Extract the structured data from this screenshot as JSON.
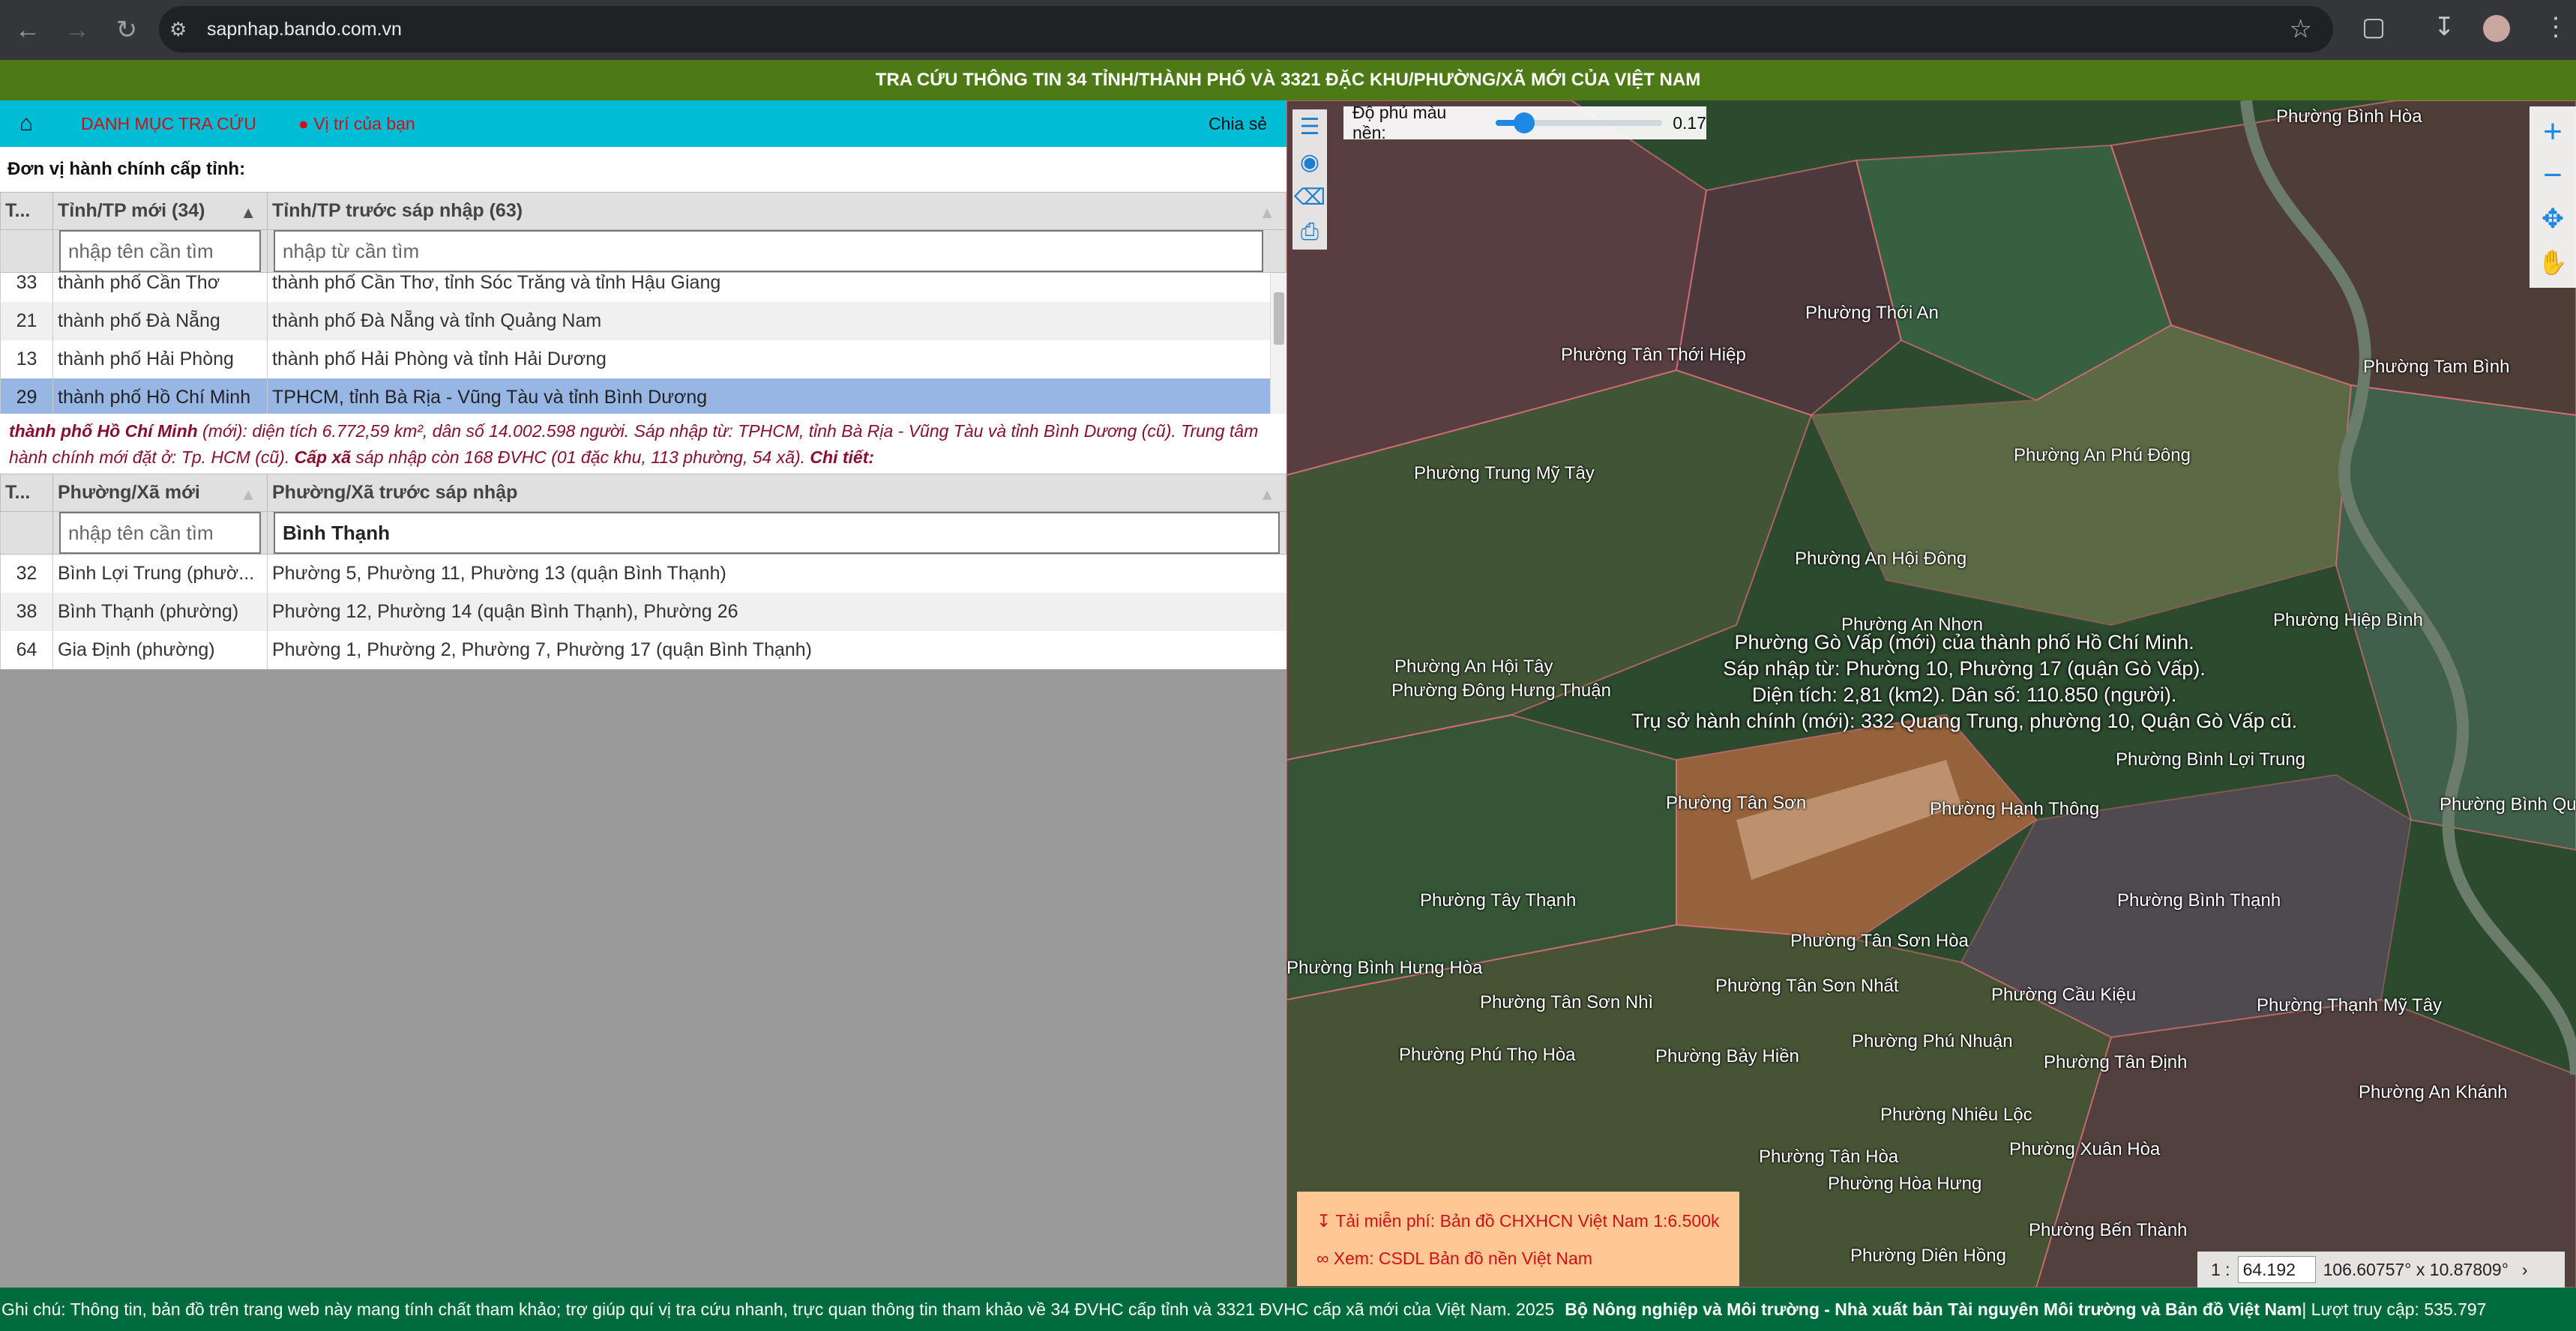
{
  "browser": {
    "url": "sapnhap.bando.com.vn"
  },
  "banner": {
    "title": "TRA CỨU THÔNG TIN 34 TỈNH/THÀNH PHỐ VÀ 3321 ĐẶC KHU/PHƯỜNG/XÃ MỚI CỦA VIỆT NAM"
  },
  "menu": {
    "catalog": "DANH MỤC TRA CỨU",
    "location": "Vị trí của bạn",
    "share": "Chia sẻ"
  },
  "province_section": {
    "label": "Đơn vị hành chính cấp tỉnh:"
  },
  "province_table": {
    "headers": [
      "T...",
      "Tỉnh/TP mới (34)",
      "Tỉnh/TP trước sáp nhập (63)"
    ],
    "filter_new_placeholder": "nhập tên cần tìm",
    "filter_old_placeholder": "nhập từ cần tìm",
    "rows": [
      {
        "no": "33",
        "new": "thành phố Cần Thơ",
        "old": "thành phố Cần Thơ, tỉnh Sóc Trăng và tỉnh Hậu Giang"
      },
      {
        "no": "21",
        "new": "thành phố Đà Nẵng",
        "old": "thành phố Đà Nẵng và tỉnh Quảng Nam"
      },
      {
        "no": "13",
        "new": "thành phố Hải Phòng",
        "old": "thành phố Hải Phòng và tỉnh Hải Dương"
      },
      {
        "no": "29",
        "new": "thành phố Hồ Chí Minh",
        "old": "TPHCM, tỉnh Bà Rịa - Vũng Tàu và tỉnh Bình Dương"
      }
    ]
  },
  "info": {
    "name": "thành phố Hồ Chí Minh",
    "line1": " (mới): diện tích 6.772,59 km², dân số 14.002.598 người. Sáp nhập từ: TPHCM, tỉnh Bà Rịa - Vũng Tàu và tỉnh Bình Dương (cũ). Trung tâm hành chính mới đặt ở: Tp. HCM (cũ). ",
    "cap_xa": "Cấp xã",
    "line2": " sáp nhập còn 168 ĐVHC (01 đặc khu, 113 phường, 54 xã). ",
    "detail": "Chi tiết:"
  },
  "ward_table": {
    "headers": [
      "T...",
      "Phường/Xã mới",
      "Phường/Xã trước sáp nhập"
    ],
    "filter_new_placeholder": "nhập tên cần tìm",
    "filter_old_value": "Bình Thạnh",
    "rows": [
      {
        "no": "32",
        "new": "Bình Lợi Trung (phườ...",
        "old": "Phường 5, Phường 11, Phường 13 (quận Bình Thạnh)"
      },
      {
        "no": "38",
        "new": "Bình Thạnh (phường)",
        "old": "Phường 12, Phường 14 (quận Bình Thạnh), Phường 26"
      },
      {
        "no": "64",
        "new": "Gia Định (phường)",
        "old": "Phường 1, Phường 2, Phường 7, Phường 17 (quận Bình Thạnh)"
      }
    ]
  },
  "map": {
    "opacity_label": "Độ phủ màu nền:",
    "opacity_value": "0.17",
    "opacity_level": 0.17,
    "labels": [
      "Phường Bình Hòa",
      "Phường Thới An",
      "Phường Tân Thới Hiệp",
      "Phường Tam Bình",
      "Phường An Phú Đông",
      "Phường Trung Mỹ Tây",
      "Phường An Hội Đông",
      "Phường Hiệp Bình",
      "Phường An Nhơn",
      "Phường An Hội Tây",
      "Phường Đông Hưng Thuận",
      "Phường Bình Lợi Trung",
      "Phường Tân Sơn",
      "Phường Hạnh Thông",
      "Phường Bình Quới",
      "Phường Tây Thạnh",
      "Phường Bình Thạnh",
      "Phường Tân Sơn Hòa",
      "Phường Bình Hưng Hòa",
      "Phường Tân Sơn Nhì",
      "Phường Tân Sơn Nhất",
      "Phường Cầu Kiệu",
      "Phường Thạnh Mỹ Tây",
      "Phường Phú Thọ Hòa",
      "Phường Bảy Hiền",
      "Phường Phú Nhuận",
      "Phường Tân Định",
      "Phường An Khánh",
      "Phường Nhiêu Lộc",
      "Phường Tân Hòa",
      "Phường Xuân Hòa",
      "Phường Hòa Hưng",
      "Phường Bến Thành",
      "Phường Diên Hồng"
    ],
    "popup": [
      "Phường Gò Vấp (mới) của thành phố Hồ Chí Minh.",
      "Sáp nhập từ: Phường 10, Phường 17 (quận Gò Vấp).",
      "Diện tích: 2,81 (km2). Dân số: 110.850 (người).",
      "Trụ sở hành chính (mới): 332 Quang Trung, phường 10, Quận Gò Vấp cũ."
    ],
    "download": "Tải miễn phí: Bản đồ CHXHCN Việt Nam 1:6.500k",
    "view": "Xem: CSDL Bản đồ nền Việt Nam",
    "scale_prefix": "1 :",
    "scale_value": "64.192",
    "coords": "106.60757° x 10.87809°"
  },
  "footer": {
    "note": "Ghi chú: Thông tin, bản đồ trên trang web này mang tính chất tham khảo; trợ giúp quí vị tra cứu nhanh, trực quan thông tin tham khảo về 34 ĐVHC cấp tỉnh và 3321 ĐVHC cấp xã mới của Việt Nam. 2025",
    "org": "Bộ Nông nghiệp và Môi trường - Nhà xuất bản Tài nguyên Môi trường và Bản đồ Việt Nam",
    "visits": " | Lượt truy cập: 535.797"
  }
}
